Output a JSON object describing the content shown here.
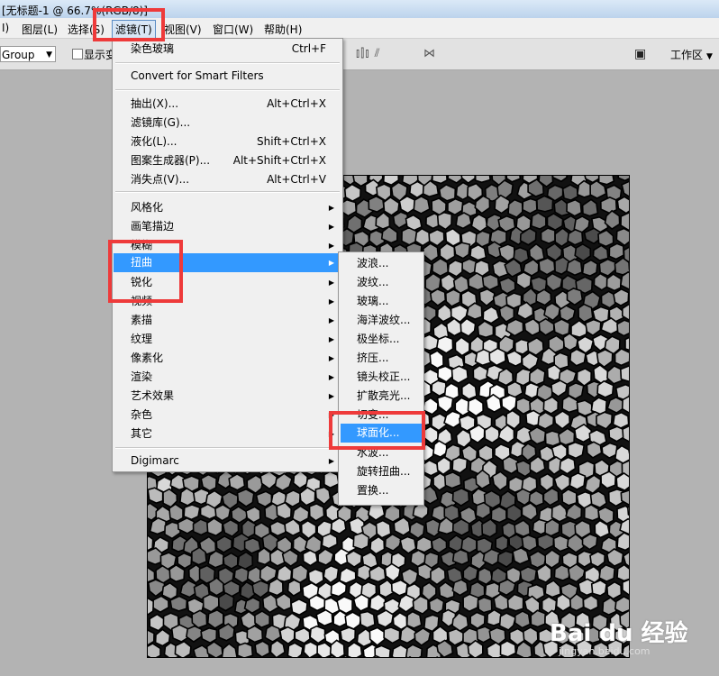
{
  "window": {
    "title": "[无标题-1 @ 66.7%(RGB/8)]"
  },
  "menubar": {
    "items": [
      {
        "label": "I)"
      },
      {
        "label": "图层(L)"
      },
      {
        "label": "选择(S)"
      },
      {
        "label": "滤镜(T)"
      },
      {
        "label": "视图(V)"
      },
      {
        "label": "窗口(W)"
      },
      {
        "label": "帮助(H)"
      }
    ],
    "active_index": 3
  },
  "options_bar": {
    "auto_select_value": "Group",
    "show_transform_label": "显示变换控件",
    "workspace_label": "工作区"
  },
  "filter_menu": {
    "top": [
      {
        "label": "染色玻璃",
        "shortcut": "Ctrl+F"
      }
    ],
    "smart": [
      {
        "label": "Convert for Smart Filters"
      }
    ],
    "tools": [
      {
        "label": "抽出(X)...",
        "shortcut": "Alt+Ctrl+X"
      },
      {
        "label": "滤镜库(G)...",
        "shortcut": ""
      },
      {
        "label": "液化(L)...",
        "shortcut": "Shift+Ctrl+X"
      },
      {
        "label": "图案生成器(P)...",
        "shortcut": "Alt+Shift+Ctrl+X"
      },
      {
        "label": "消失点(V)...",
        "shortcut": "Alt+Ctrl+V"
      }
    ],
    "groups": [
      {
        "label": "风格化"
      },
      {
        "label": "画笔描边"
      },
      {
        "label": "模糊"
      },
      {
        "label": "扭曲"
      },
      {
        "label": "锐化"
      },
      {
        "label": "视频"
      },
      {
        "label": "素描"
      },
      {
        "label": "纹理"
      },
      {
        "label": "像素化"
      },
      {
        "label": "渲染"
      },
      {
        "label": "艺术效果"
      },
      {
        "label": "杂色"
      },
      {
        "label": "其它"
      }
    ],
    "highlighted_group": "扭曲",
    "plugins": [
      {
        "label": "Digimarc"
      }
    ]
  },
  "distort_submenu": {
    "items": [
      {
        "label": "波浪..."
      },
      {
        "label": "波纹..."
      },
      {
        "label": "玻璃..."
      },
      {
        "label": "海洋波纹..."
      },
      {
        "label": "极坐标..."
      },
      {
        "label": "挤压..."
      },
      {
        "label": "镜头校正..."
      },
      {
        "label": "扩散亮光..."
      },
      {
        "label": "切变..."
      },
      {
        "label": "球面化..."
      },
      {
        "label": "水波..."
      },
      {
        "label": "旋转扭曲..."
      },
      {
        "label": "置换..."
      }
    ],
    "highlighted": "球面化..."
  },
  "watermark": {
    "logo": "Bai du 经验",
    "url": "jingyan.baidu.com"
  },
  "colors": {
    "highlight": "#3399ff",
    "annotation": "#ee3a3a",
    "menu_bg": "#f0f0f0",
    "canvas_bg": "#b3b3b3"
  }
}
